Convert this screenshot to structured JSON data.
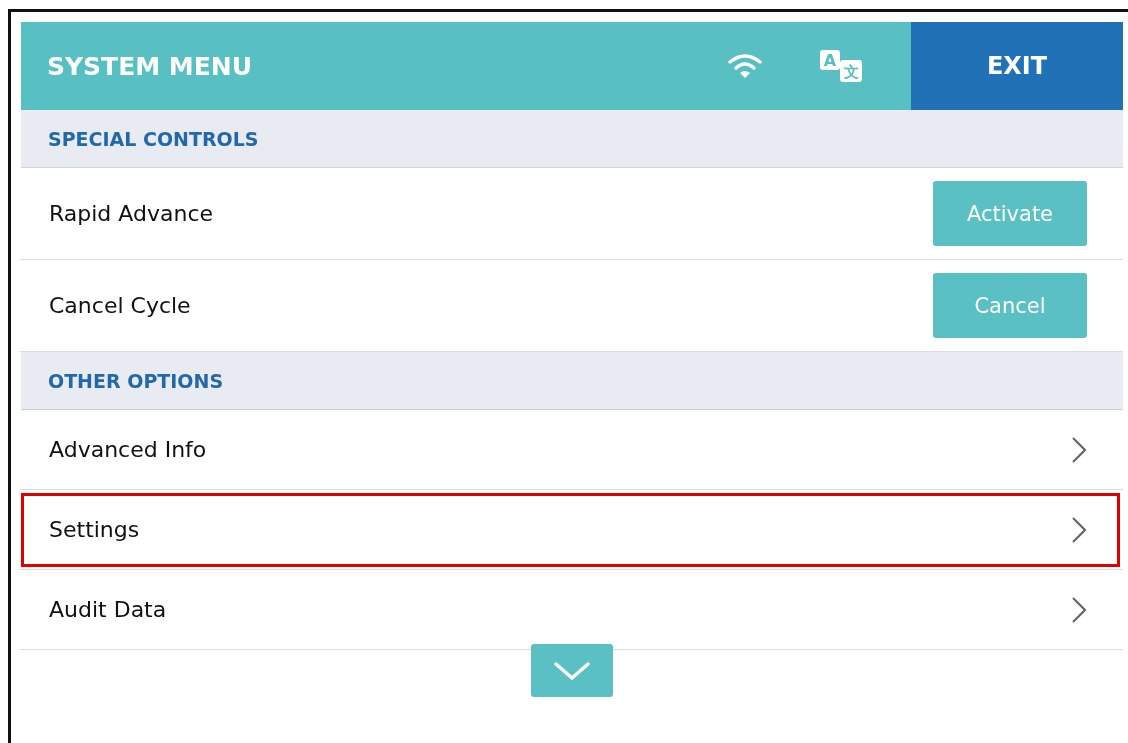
{
  "header": {
    "title": "SYSTEM MENU",
    "language_icon": {
      "latin": "A",
      "cjk": "文"
    },
    "exit_button": "EXIT"
  },
  "sections": [
    {
      "title": "SPECIAL CONTROLS",
      "rows": [
        {
          "kind": "action",
          "label": "Rapid Advance",
          "button": "Activate",
          "highlighted": false
        },
        {
          "kind": "action",
          "label": "Cancel Cycle",
          "button": "Cancel",
          "highlighted": false
        }
      ]
    },
    {
      "title": "OTHER OPTIONS",
      "rows": [
        {
          "kind": "link",
          "label": "Advanced Info",
          "highlighted": false
        },
        {
          "kind": "link",
          "label": "Settings",
          "highlighted": true
        },
        {
          "kind": "link",
          "label": "Audit Data",
          "highlighted": false
        }
      ]
    }
  ]
}
